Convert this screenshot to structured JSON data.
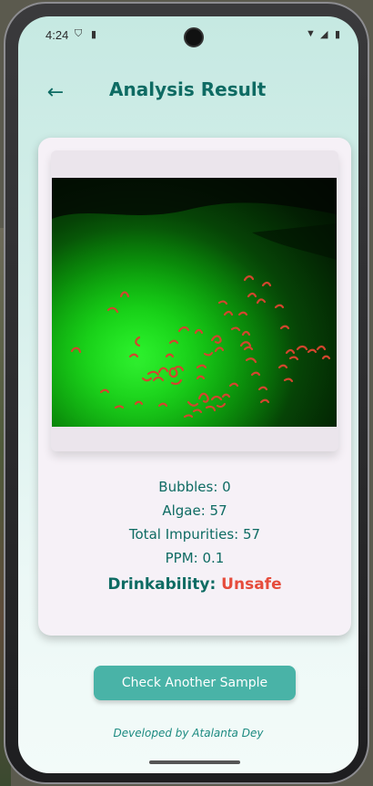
{
  "status_bar": {
    "time": "4:24"
  },
  "app_bar": {
    "title": "Analysis Result"
  },
  "results": {
    "bubbles": "Bubbles: 0",
    "algae": "Algae: 57",
    "total_impurities": "Total Impurities: 57",
    "ppm": "PPM: 0.1",
    "drinkability_label": "Drinkability: ",
    "drinkability_value": "Unsafe"
  },
  "actions": {
    "check_another_label": "Check Another Sample"
  },
  "footer": {
    "credit": "Developed by Atalanta Dey"
  },
  "colors": {
    "primary": "#0e6b63",
    "button": "#49b3a7",
    "unsafe": "#e64c3c"
  },
  "icons": {
    "back": "arrow-left-icon",
    "wifi": "wifi-icon",
    "signal": "signal-icon",
    "battery": "battery-icon"
  }
}
